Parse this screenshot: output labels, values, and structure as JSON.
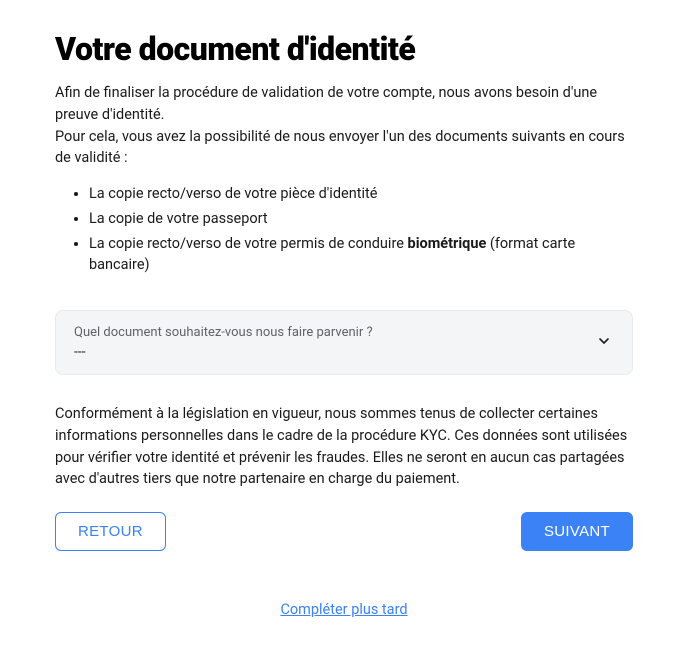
{
  "title": "Votre document d'identité",
  "intro1": "Afin de finaliser la procédure de validation de votre compte, nous avons besoin d'une preuve d'identité.",
  "intro2": "Pour cela, vous avez la possibilité de nous envoyer l'un des documents suivants en cours de validité :",
  "list": {
    "item0": "La copie recto/verso de votre pièce d'identité",
    "item1": "La copie de votre passeport",
    "item2_prefix": "La copie recto/verso de votre permis de conduire ",
    "item2_strong": "biométrique",
    "item2_suffix": " (format carte bancaire)"
  },
  "select": {
    "label": "Quel document souhaitez-vous nous faire parvenir ?",
    "value": "---"
  },
  "legal": "Conformément à la législation en vigueur, nous sommes tenus de collecter certaines informations personnelles dans le cadre de la procédure KYC. Ces données sont utilisées pour vérifier votre identité et prévenir les fraudes. Elles ne seront en aucun cas partagées avec d'autres tiers que notre partenaire en charge du paiement.",
  "buttons": {
    "back": "RETOUR",
    "next": "SUIVANT"
  },
  "later_link": "Compléter plus tard"
}
